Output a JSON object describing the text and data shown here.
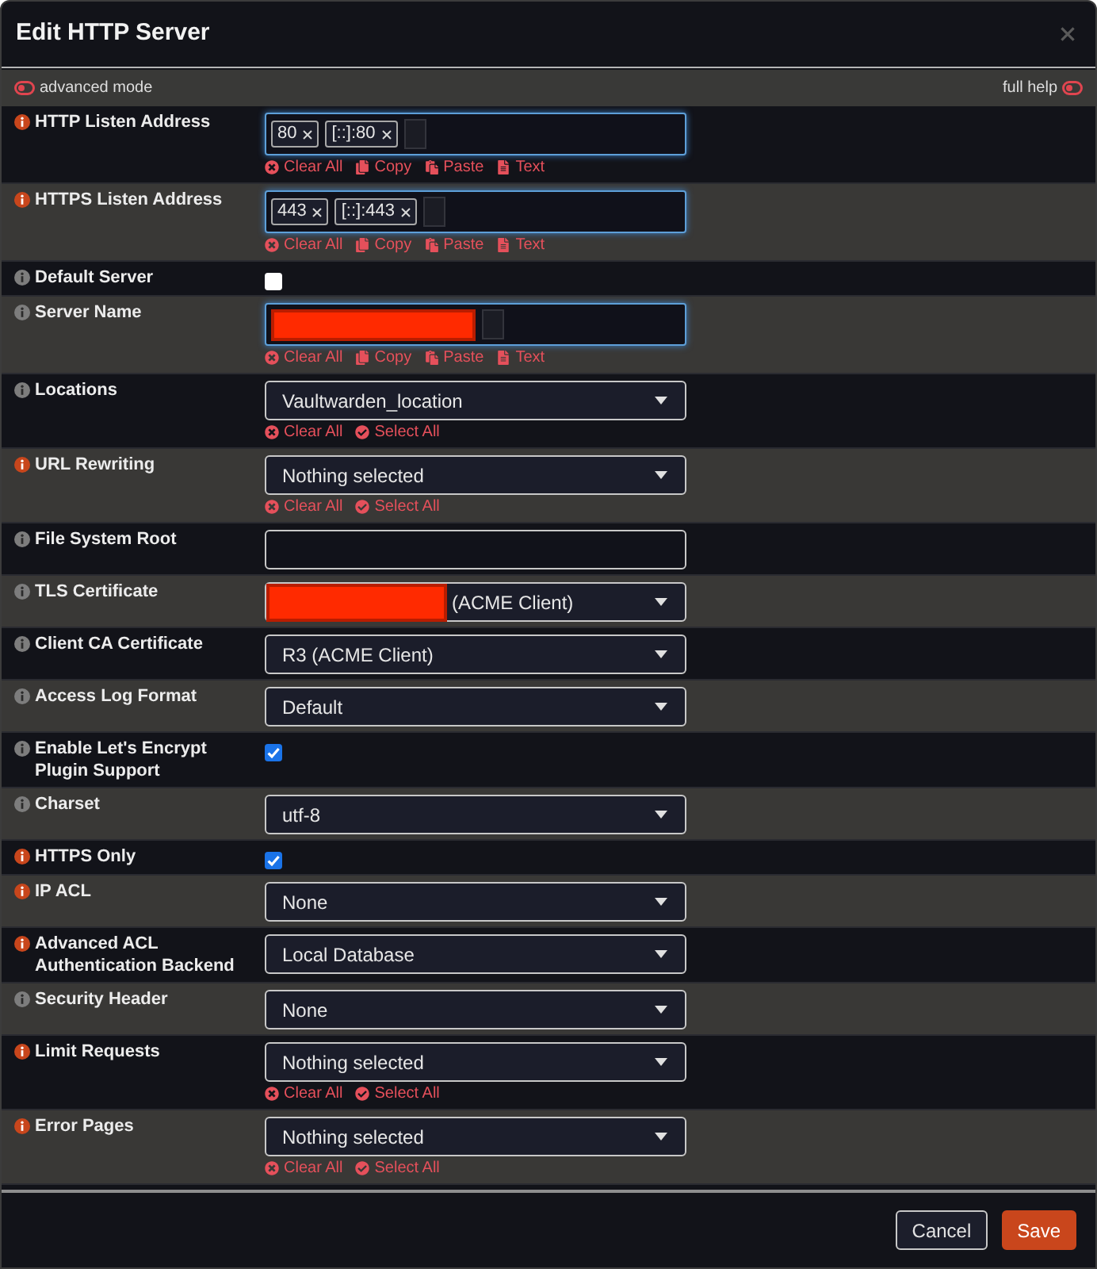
{
  "dialog": {
    "title": "Edit HTTP Server"
  },
  "mode_bar": {
    "advanced_mode": {
      "label": "advanced mode",
      "on": false
    },
    "full_help": {
      "label": "full help",
      "on": false
    }
  },
  "fields": [
    {
      "label": "HTTP Listen Address",
      "highlighted": true,
      "kind": "tags",
      "tags": [
        {
          "label": "80",
          "redacted": false
        },
        {
          "label": "[::]:80",
          "redacted": false
        }
      ],
      "actions": [
        {
          "kind": "clear",
          "label": "Clear All"
        },
        {
          "kind": "copy",
          "label": "Copy"
        },
        {
          "kind": "paste",
          "label": "Paste"
        },
        {
          "kind": "text",
          "label": "Text"
        }
      ]
    },
    {
      "label": "HTTPS Listen Address",
      "highlighted": true,
      "kind": "tags",
      "tags": [
        {
          "label": "443",
          "redacted": false
        },
        {
          "label": "[::]:443",
          "redacted": false
        }
      ],
      "actions": [
        {
          "kind": "clear",
          "label": "Clear All"
        },
        {
          "kind": "copy",
          "label": "Copy"
        },
        {
          "kind": "paste",
          "label": "Paste"
        },
        {
          "kind": "text",
          "label": "Text"
        }
      ]
    },
    {
      "label": "Default Server",
      "highlighted": false,
      "kind": "checkbox",
      "checked": false
    },
    {
      "label": "Server Name",
      "highlighted": false,
      "kind": "tags",
      "tags": [
        {
          "redacted": true
        }
      ],
      "actions": [
        {
          "kind": "clear",
          "label": "Clear All"
        },
        {
          "kind": "copy",
          "label": "Copy"
        },
        {
          "kind": "paste",
          "label": "Paste"
        },
        {
          "kind": "text",
          "label": "Text"
        }
      ]
    },
    {
      "label": "Locations",
      "highlighted": false,
      "kind": "select",
      "value": "Vaultwarden_location",
      "redacted": false,
      "actions": [
        {
          "kind": "clear",
          "label": "Clear All"
        },
        {
          "kind": "select_all",
          "label": "Select All"
        }
      ]
    },
    {
      "label": "URL Rewriting",
      "highlighted": true,
      "kind": "select",
      "value": "Nothing selected",
      "redacted": false,
      "actions": [
        {
          "kind": "clear",
          "label": "Clear All"
        },
        {
          "kind": "select_all",
          "label": "Select All"
        }
      ]
    },
    {
      "label": "File System Root",
      "highlighted": false,
      "kind": "text"
    },
    {
      "label": "TLS Certificate",
      "highlighted": false,
      "kind": "select",
      "value": "(ACME Client)",
      "redacted": true
    },
    {
      "label": "Client CA Certificate",
      "highlighted": false,
      "kind": "select",
      "value": "R3 (ACME Client)",
      "redacted": false
    },
    {
      "label": "Access Log Format",
      "highlighted": false,
      "kind": "select",
      "value": "Default",
      "redacted": false
    },
    {
      "label": "Enable Let's Encrypt Plugin Support",
      "highlighted": false,
      "kind": "checkbox",
      "checked": true
    },
    {
      "label": "Charset",
      "highlighted": false,
      "kind": "select",
      "value": "utf-8",
      "redacted": false
    },
    {
      "label": "HTTPS Only",
      "highlighted": true,
      "kind": "checkbox",
      "checked": true
    },
    {
      "label": "IP ACL",
      "highlighted": true,
      "kind": "select",
      "value": "None",
      "redacted": false
    },
    {
      "label": "Advanced ACL Authentication Backend",
      "highlighted": true,
      "kind": "select",
      "value": "Local Database",
      "redacted": false
    },
    {
      "label": "Security Header",
      "highlighted": false,
      "kind": "select",
      "value": "None",
      "redacted": false
    },
    {
      "label": "Limit Requests",
      "highlighted": true,
      "kind": "select",
      "value": "Nothing selected",
      "redacted": false,
      "actions": [
        {
          "kind": "clear",
          "label": "Clear All"
        },
        {
          "kind": "select_all",
          "label": "Select All"
        }
      ]
    },
    {
      "label": "Error Pages",
      "highlighted": true,
      "kind": "select",
      "value": "Nothing selected",
      "redacted": false,
      "actions": [
        {
          "kind": "clear",
          "label": "Clear All"
        },
        {
          "kind": "select_all",
          "label": "Select All"
        }
      ]
    }
  ],
  "buttons": [
    {
      "label": "Cancel",
      "kind": "secondary"
    },
    {
      "label": "Save",
      "kind": "primary"
    }
  ]
}
